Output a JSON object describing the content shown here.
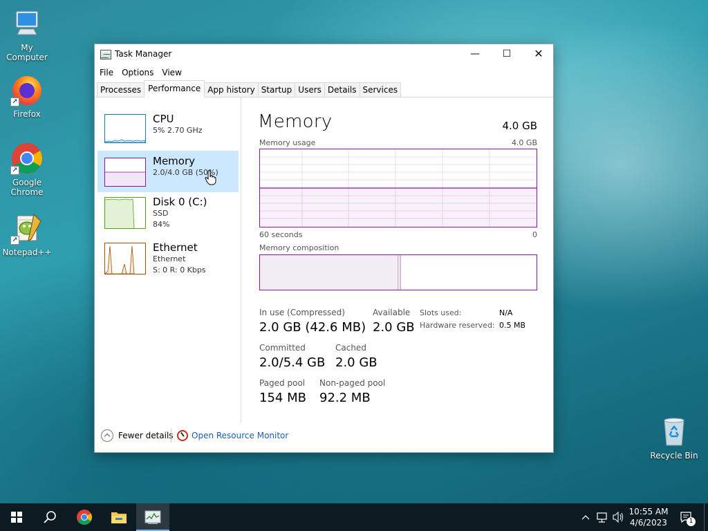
{
  "desktop": {
    "icons": [
      {
        "label": "My Computer"
      },
      {
        "label": "Firefox"
      },
      {
        "label": "Google Chrome"
      },
      {
        "label": "Notepad++"
      },
      {
        "label": "Recycle Bin"
      }
    ]
  },
  "window": {
    "title": "Task Manager",
    "minimize_glyph": "—",
    "maximize_glyph": "☐",
    "close_glyph": "✕"
  },
  "menu": [
    "File",
    "Options",
    "View"
  ],
  "tabs": [
    "Processes",
    "Performance",
    "App history",
    "Startup",
    "Users",
    "Details",
    "Services"
  ],
  "active_tab": "Performance",
  "sidebar": {
    "items": [
      {
        "title": "CPU",
        "line1": "5% 2.70 GHz",
        "line2": "",
        "color": "#117dbb"
      },
      {
        "title": "Memory",
        "line1": "2.0/4.0 GB (50%)",
        "line2": "",
        "color": "#8b12ae"
      },
      {
        "title": "Disk 0 (C:)",
        "line1": "SSD",
        "line2": "84%",
        "color": "#4da60c"
      },
      {
        "title": "Ethernet",
        "line1": "Ethernet",
        "line2": "S: 0 R: 0 Kbps",
        "color": "#a74f01"
      }
    ],
    "selected": "Memory"
  },
  "memory": {
    "title": "Memory",
    "total": "4.0 GB",
    "usage_label": "Memory usage",
    "usage_max": "4.0 GB",
    "time_left": "60 seconds",
    "time_right": "0",
    "usage_fraction": 0.5,
    "composition_label": "Memory composition",
    "composition_in_use_fraction": 0.5,
    "stats": {
      "in_use_label": "In use (Compressed)",
      "in_use_value": "2.0 GB (42.6 MB)",
      "available_label": "Available",
      "available_value": "2.0 GB",
      "committed_label": "Committed",
      "committed_value": "2.0/5.4 GB",
      "cached_label": "Cached",
      "cached_value": "2.0 GB",
      "paged_pool_label": "Paged pool",
      "paged_pool_value": "154 MB",
      "non_paged_pool_label": "Non-paged pool",
      "non_paged_pool_value": "92.2 MB"
    },
    "details": {
      "slots_used_label": "Slots used:",
      "slots_used_value": "N/A",
      "hardware_reserved_label": "Hardware reserved:",
      "hardware_reserved_value": "0.5 MB"
    }
  },
  "footer": {
    "fewer_details": "Fewer details",
    "open_resource_monitor": "Open Resource Monitor"
  },
  "taskbar": {
    "time": "10:55 AM",
    "date": "4/6/2023",
    "notification_count": "1"
  },
  "colors": {
    "memory_accent": "#8b12ae",
    "selected_bg": "#cce8ff",
    "link": "#1a5fb4"
  }
}
